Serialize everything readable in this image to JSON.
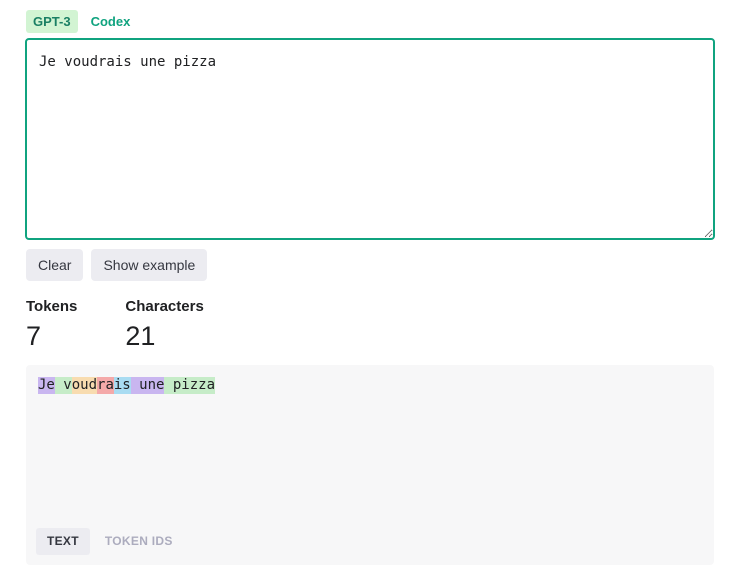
{
  "model_tabs": {
    "gpt3_label": "GPT-3",
    "codex_label": "Codex",
    "active": "GPT-3"
  },
  "input": {
    "value": "Je voudrais une pizza",
    "placeholder": ""
  },
  "buttons": {
    "clear_label": "Clear",
    "show_example_label": "Show example"
  },
  "stats": {
    "tokens_label": "Tokens",
    "tokens_value": "7",
    "characters_label": "Characters",
    "characters_value": "21"
  },
  "tokens": [
    {
      "text": "Je",
      "color": "#c9b6f0"
    },
    {
      "text": " v",
      "color": "#c6ecc8"
    },
    {
      "text": "oud",
      "color": "#f8dcb0"
    },
    {
      "text": "ra",
      "color": "#f4a9a9"
    },
    {
      "text": "is",
      "color": "#a9dcf2"
    },
    {
      "text": " une",
      "color": "#c9b6f0"
    },
    {
      "text": " pizza",
      "color": "#c6ecc8"
    }
  ],
  "view_tabs": {
    "text_label": "TEXT",
    "token_ids_label": "TOKEN IDS",
    "active": "TEXT"
  }
}
